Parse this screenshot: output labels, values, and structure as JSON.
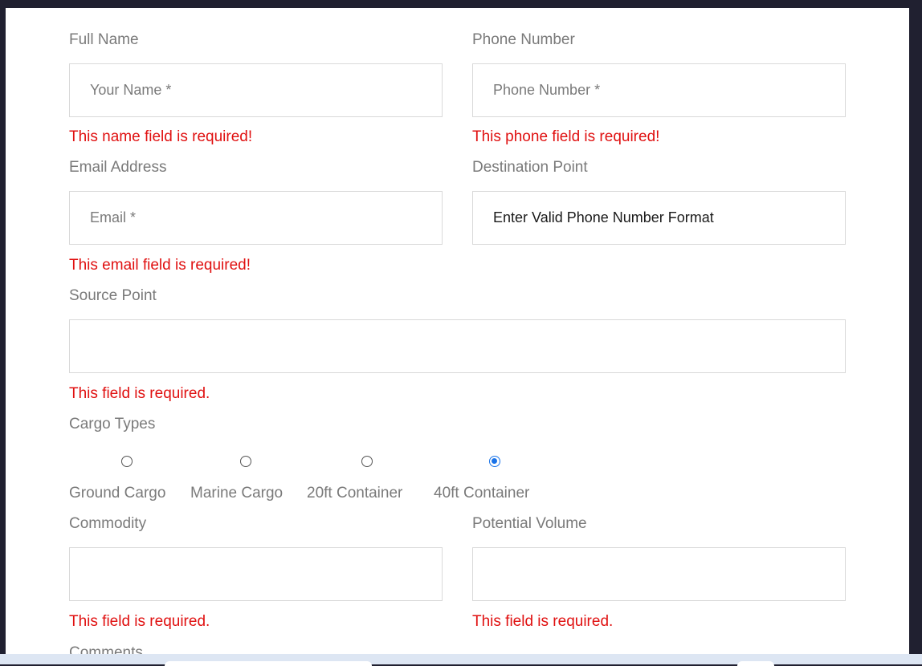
{
  "form": {
    "full_name": {
      "label": "Full Name",
      "placeholder": "Your Name *",
      "error": "This name field is required!"
    },
    "phone": {
      "label": "Phone Number",
      "placeholder": "Phone Number *",
      "error": "This phone field is required!"
    },
    "email": {
      "label": "Email Address",
      "placeholder": "Email *",
      "error": "This email field is required!"
    },
    "destination": {
      "label": "Destination Point",
      "value": "Enter Valid Phone Number Format"
    },
    "source": {
      "label": "Source Point",
      "value": "",
      "error": "This field is required."
    },
    "cargo": {
      "label": "Cargo Types",
      "options": [
        "Ground Cargo",
        "Marine Cargo",
        "20ft Container",
        "40ft Container"
      ],
      "selected": "40ft Container"
    },
    "commodity": {
      "label": "Commodity",
      "value": "",
      "error": "This field is required."
    },
    "volume": {
      "label": "Potential Volume",
      "value": "",
      "error": "This field is required."
    },
    "comments": {
      "label": "Comments"
    }
  },
  "colors": {
    "error": "#e01010",
    "label": "#7a7a7a",
    "radio_selected": "#1a73e8",
    "frame": "#202030"
  }
}
